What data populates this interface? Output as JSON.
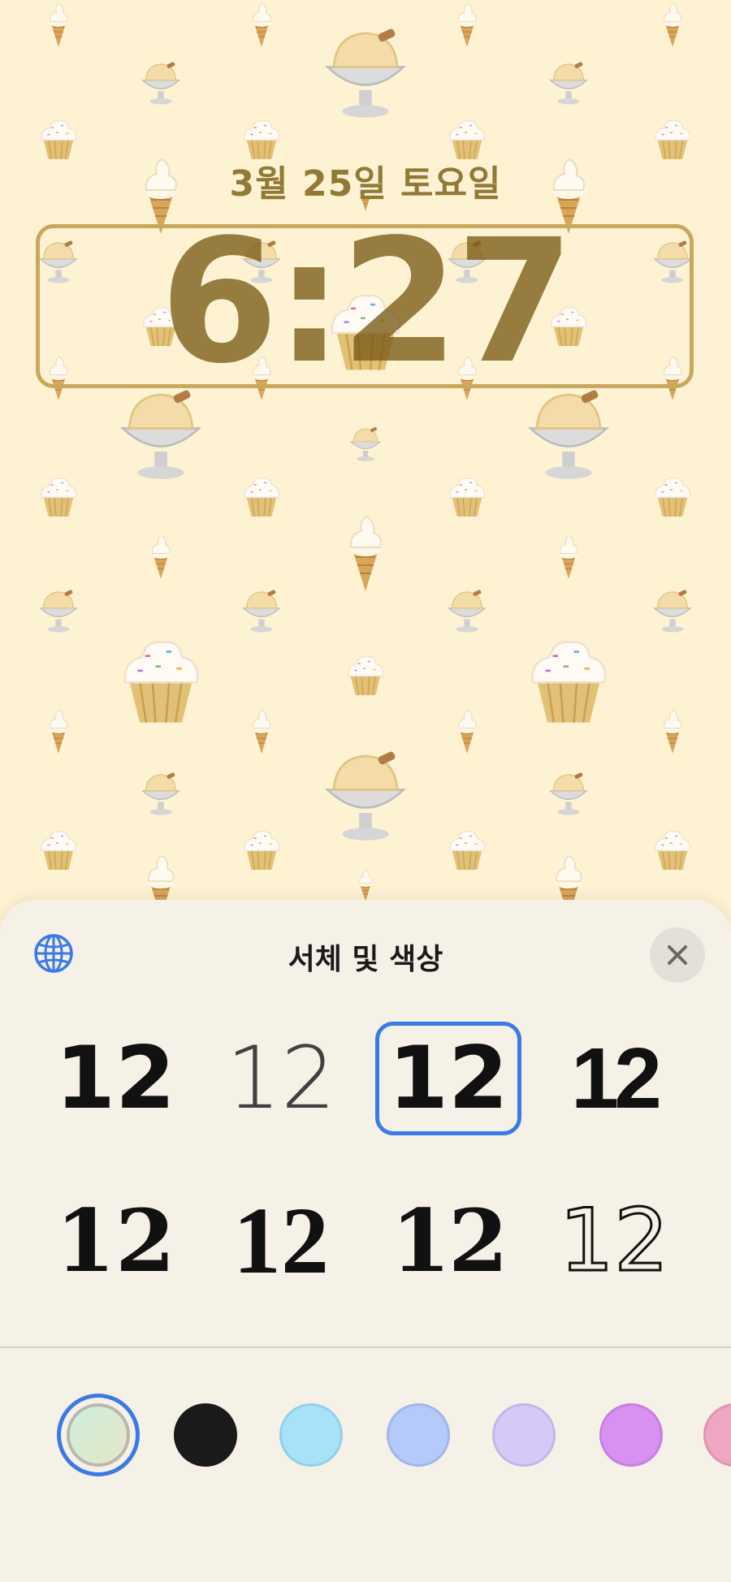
{
  "lockscreen": {
    "date": "3월 25일 토요일",
    "time": "6:27"
  },
  "sheet": {
    "title": "서체 및 색상",
    "globe_icon": "globe-icon",
    "close_icon": "close-icon"
  },
  "font_options": [
    {
      "label": "12",
      "style": "bold-rounded"
    },
    {
      "label": "12",
      "style": "thin"
    },
    {
      "label": "12",
      "style": "rounded",
      "selected": true
    },
    {
      "label": "12",
      "style": "bold-condensed"
    },
    {
      "label": "12",
      "style": "serif-bold"
    },
    {
      "label": "12",
      "style": "serif-heavy"
    },
    {
      "label": "12",
      "style": "slab-bold"
    },
    {
      "label": "12",
      "style": "outline"
    }
  ],
  "color_swatches": [
    {
      "name": "gradient",
      "color": "#d6e8cf",
      "selected": true
    },
    {
      "name": "black",
      "color": "#1a1a1a"
    },
    {
      "name": "sky",
      "color": "#a6e3f8"
    },
    {
      "name": "periwinkle",
      "color": "#b5c9fb"
    },
    {
      "name": "lavender",
      "color": "#d7c9f7"
    },
    {
      "name": "violet",
      "color": "#d890f3"
    },
    {
      "name": "pink",
      "color": "#f0a6c3"
    }
  ]
}
